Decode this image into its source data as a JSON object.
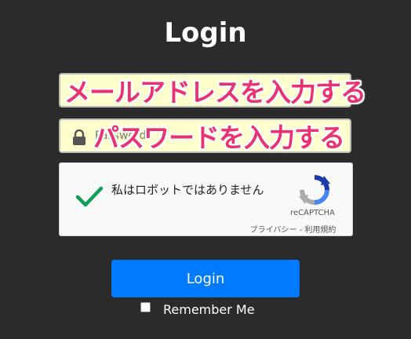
{
  "page": {
    "title": "Login"
  },
  "form": {
    "email": {
      "placeholder": "",
      "overlay": "メールアドレスを入力する"
    },
    "password": {
      "placeholder": "Password",
      "overlay": "パスワードを入力する"
    },
    "recaptcha": {
      "label": "私はロボットではありません",
      "brand": "reCAPTCHA",
      "privacy": "プライバシー",
      "separator": " - ",
      "terms": "利用規約",
      "checked": true
    },
    "submit_label": "Login",
    "remember": {
      "label": "Remember Me",
      "checked": false
    }
  },
  "colors": {
    "background": "#2b2b2b",
    "accent": "#007bff",
    "field_fill": "#ffffcc",
    "overlay_text": "#e8336f",
    "check_green": "#0f9d58"
  },
  "icons": {
    "password": "lock-icon",
    "recaptcha_check": "checkmark-icon",
    "recaptcha_logo": "recaptcha-logo-icon"
  }
}
